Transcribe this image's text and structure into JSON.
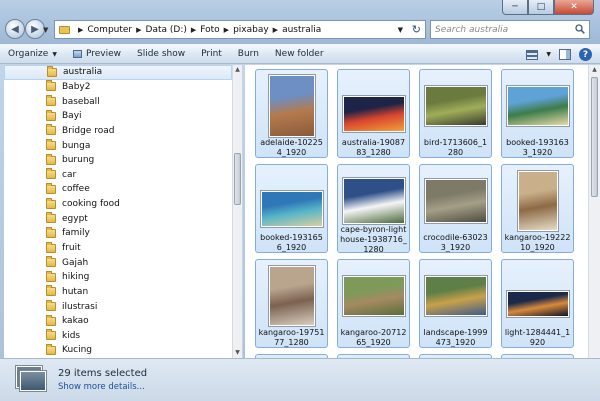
{
  "address": {
    "crumbs": [
      "Computer",
      "Data (D:)",
      "Foto",
      "pixabay",
      "australia"
    ]
  },
  "search": {
    "placeholder": "Search australia"
  },
  "toolbar": {
    "organize": "Organize",
    "preview": "Preview",
    "slideshow": "Slide show",
    "print": "Print",
    "burn": "Burn",
    "new_folder": "New folder"
  },
  "nav": {
    "folders": [
      "australia",
      "Baby2",
      "baseball",
      "Bayi",
      "Bridge road",
      "bunga",
      "burung",
      "car",
      "coffee",
      "cooking food",
      "egypt",
      "family",
      "fruit",
      "Gajah",
      "hiking",
      "hutan",
      "ilustrasi",
      "kakao",
      "kids",
      "Kucing"
    ],
    "selected_index": 0
  },
  "files": [
    {
      "name": "adelaide-102254_1920",
      "colors": [
        "#6d8fc4",
        "#b47a4e",
        "#8a5a3c"
      ]
    },
    {
      "name": "australia-1908783_1280",
      "colors": [
        "#1d2447",
        "#d8452e",
        "#f2a13a"
      ]
    },
    {
      "name": "bird-1713606_1280",
      "colors": [
        "#6b7a3e",
        "#9fae5a",
        "#3a3a2e"
      ]
    },
    {
      "name": "booked-1931633_1920",
      "colors": [
        "#5fa2d6",
        "#3d7c4a",
        "#e7d9a8"
      ]
    },
    {
      "name": "booked-1931656_1920",
      "colors": [
        "#2f78b8",
        "#57b5c9",
        "#d9cfa0"
      ]
    },
    {
      "name": "cape-byron-lighthouse-1938716_1280",
      "colors": [
        "#2e4f88",
        "#f5f5f5",
        "#4b6a3a"
      ]
    },
    {
      "name": "crocodile-630233_1920",
      "colors": [
        "#7d7a68",
        "#a49f86",
        "#4e4c40"
      ]
    },
    {
      "name": "kangaroo-1922210_1920",
      "colors": [
        "#c9b08a",
        "#8d6a46",
        "#e6dcc6"
      ]
    },
    {
      "name": "kangaroo-1975177_1280",
      "colors": [
        "#b9a48e",
        "#7b6250",
        "#d9cdbf"
      ]
    },
    {
      "name": "kangaroo-2071265_1920",
      "colors": [
        "#7d9a5a",
        "#a58a62",
        "#5a6e3a"
      ]
    },
    {
      "name": "landscape-1999473_1920",
      "colors": [
        "#5e7f47",
        "#c8a14a",
        "#3f5a8a"
      ]
    },
    {
      "name": "light-1284441_1920",
      "colors": [
        "#1b2a4a",
        "#d98a3a",
        "#0d1426"
      ]
    }
  ],
  "details": {
    "count_text": "29 items selected",
    "more_text": "Show more details..."
  }
}
